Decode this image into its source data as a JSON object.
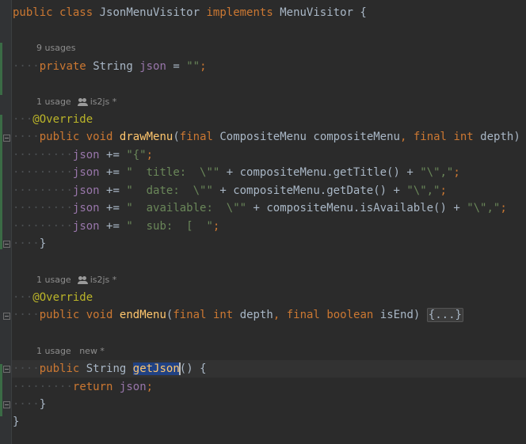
{
  "editor": {
    "class_line": {
      "kw1": "public",
      "kw2": "class",
      "name": "JsonMenuVisitor",
      "kw3": "implements",
      "iface": "MenuVisitor",
      "brace": "{"
    },
    "hints": {
      "field_usages": "9 usages",
      "draw_usages": "1 usage",
      "draw_author": "is2js *",
      "end_usages": "1 usage",
      "end_author": "is2js *",
      "get_usages": "1 usage",
      "get_author": "new *"
    },
    "field_line": {
      "kw": "private",
      "type": "String",
      "name": "json",
      "op": "=",
      "value": "\"\"",
      "semi": ";"
    },
    "annotation": "@Override",
    "draw": {
      "kw1": "public",
      "kw2": "void",
      "name": "drawMenu",
      "open": "(",
      "final1": "final",
      "ptype1": "CompositeMenu",
      "pname1": "compositeMenu",
      "comma": ",",
      "final2": "final",
      "ptype2": "int",
      "pname2": "depth",
      "close": ") {"
    },
    "body": [
      {
        "pre": " += ",
        "str": "\"{\"",
        "rest": "",
        "semi": ";"
      },
      {
        "pre": " += ",
        "str": "\"  title:  \\\"\"",
        "rest": " + compositeMenu.getTitle() + ",
        "str2": "\"\\\",\"",
        "semi": ";"
      },
      {
        "pre": " += ",
        "str": "\"  date:  \\\"\"",
        "rest": " + compositeMenu.getDate() + ",
        "str2": "\"\\\",\"",
        "semi": ";"
      },
      {
        "pre": " += ",
        "str": "\"  available:  \\\"\"",
        "rest": " + compositeMenu.isAvailable() + ",
        "str2": "\"\\\",\"",
        "semi": ";"
      },
      {
        "pre": " += ",
        "str": "\"  sub:  [  \"",
        "rest": "",
        "semi": ";"
      }
    ],
    "json_name": "json",
    "close_brace": "}",
    "end": {
      "kw1": "public",
      "kw2": "void",
      "name": "endMenu",
      "open": "(",
      "final1": "final",
      "ptype1": "int",
      "pname1": "depth",
      "comma": ",",
      "final2": "final",
      "ptype2": "boolean",
      "pname2": "isEnd",
      "close": ") ",
      "folded": "{...}"
    },
    "get": {
      "kw1": "public",
      "type": "String",
      "name": "getJson",
      "rest": "() {"
    },
    "ret": {
      "kw": "return",
      "name": "json",
      "semi": ";"
    },
    "colors": {
      "background": "#2b2b2b",
      "keyword": "#cc7832",
      "field": "#9876aa",
      "string": "#6a8759",
      "method": "#ffc66d",
      "annotation": "#bbb529",
      "selection": "#214283"
    }
  }
}
